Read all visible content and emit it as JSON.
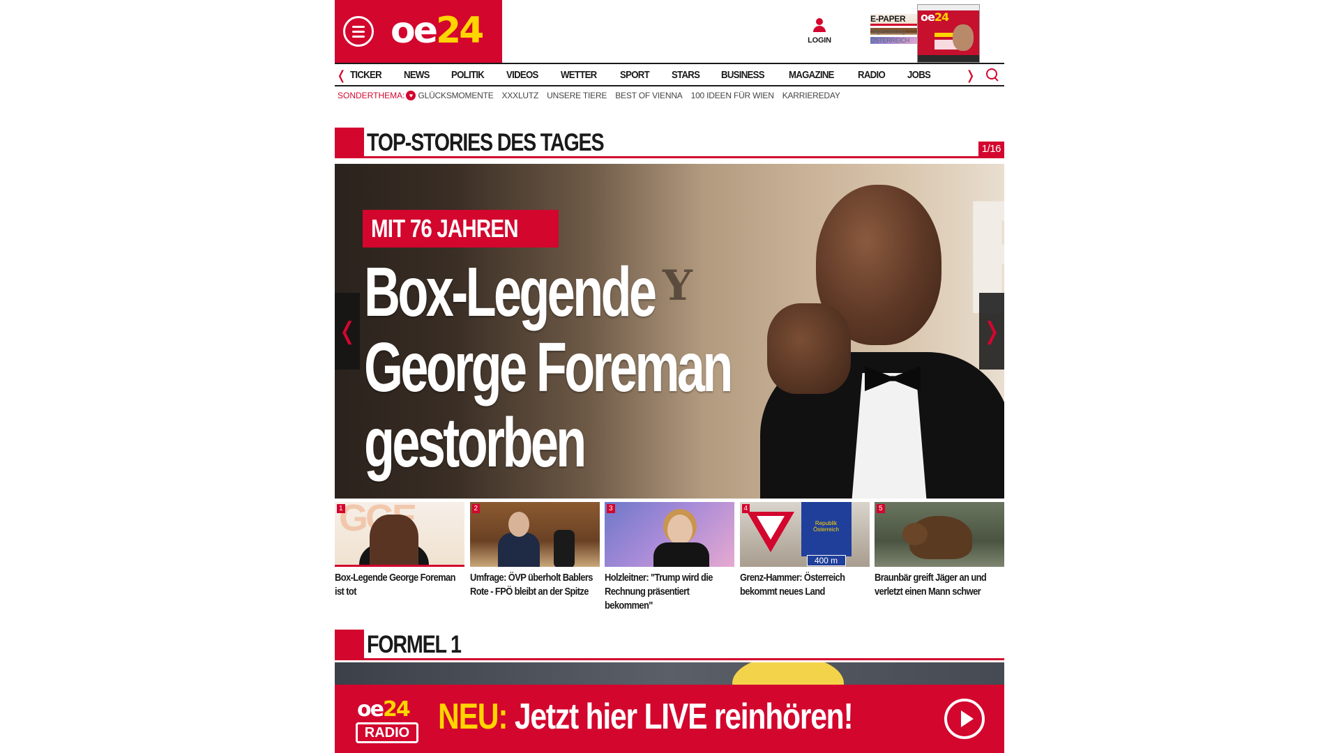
{
  "header": {
    "logo_main": "oe",
    "logo_accent": "24",
    "login_label": "LOGIN",
    "epaper_title": "E-PAPER",
    "epaper_sub1": "Tageszeitung",
    "epaper_sub2": "ÖSTERREICH"
  },
  "nav": {
    "items": [
      "TICKER",
      "NEWS",
      "POLITIK",
      "VIDEOS",
      "WETTER",
      "SPORT",
      "STARS",
      "BUSINESS",
      "MAGAZINE",
      "RADIO",
      "JOBS"
    ],
    "left_arrow": "❬",
    "right_arrow": "❭"
  },
  "subnav": {
    "label": "SONDERTHEMA:",
    "items": [
      "GLÜCKSMOMENTE",
      "XXXLUTZ",
      "UNSERE TIERE",
      "BEST OF VIENNA",
      "100 IDEEN FÜR WIEN",
      "KARRIEREDAY"
    ]
  },
  "top_stories": {
    "title": "TOP-STORIES DES TAGES",
    "counter": "1/16",
    "hero": {
      "kicker": "MIT 76 JAHREN",
      "headline_1": "Box-Legende",
      "headline_2": "George Foreman",
      "headline_3": "gestorben"
    },
    "thumbs": [
      {
        "num": "1",
        "caption": "Box-Legende George Foreman ist tot"
      },
      {
        "num": "2",
        "caption": "Umfrage: ÖVP überholt Bablers Rote - FPÖ bleibt an der Spitze"
      },
      {
        "num": "3",
        "caption": "Holzleitner: \"Trump wird die Rechnung präsentiert bekommen\""
      },
      {
        "num": "4",
        "caption": "Grenz-Hammer: Österreich bekommt neues Land",
        "sign_text": "Republik Österreich",
        "distance": "400 m"
      },
      {
        "num": "5",
        "caption": "Braunbär greift Jäger an und verletzt einen Mann schwer"
      }
    ]
  },
  "formel1": {
    "title": "FORMEL 1"
  },
  "radio_banner": {
    "logo_main": "oe",
    "logo_accent": "24",
    "logo_sub": "RADIO",
    "neu": "NEU:",
    "text": "Jetzt hier LIVE reinhören!"
  },
  "colors": {
    "brand_red": "#d3062e",
    "brand_yellow": "#ffd500"
  }
}
